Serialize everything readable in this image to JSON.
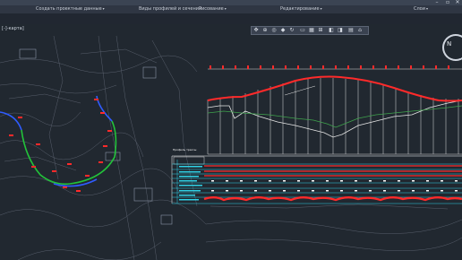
{
  "ribbon": {
    "panels": [
      {
        "label": "Создать проектные данные"
      },
      {
        "label": "Виды профилей и сечений"
      },
      {
        "label": "Рисование"
      },
      {
        "label": "Редактирование"
      },
      {
        "label": "Слои"
      }
    ]
  },
  "viewport": {
    "label": "[-]-карта]"
  },
  "window_controls": [
    "–",
    "▫",
    "✕"
  ],
  "nav_toolbar_icons": [
    "pan-icon",
    "zoom-icon",
    "orbit-icon",
    "walk-icon",
    "rotate-icon",
    "box-icon",
    "grid-icon",
    "snap-icon",
    "layers-icon",
    "view-icon",
    "sheet-icon",
    "home-icon"
  ],
  "viewcube": {
    "north": "N"
  },
  "colors": {
    "background": "#212830",
    "profile_red": "#ff2a2a",
    "surface_white": "#e6e6e6",
    "surface_green": "#3fa34d",
    "alignment_blue": "#2f5cff",
    "alignment_green": "#22c33a",
    "table_cyan": "#2fd2e6",
    "table_white": "#ffffff"
  },
  "profile_table": {
    "header": "Профиль трассы"
  }
}
